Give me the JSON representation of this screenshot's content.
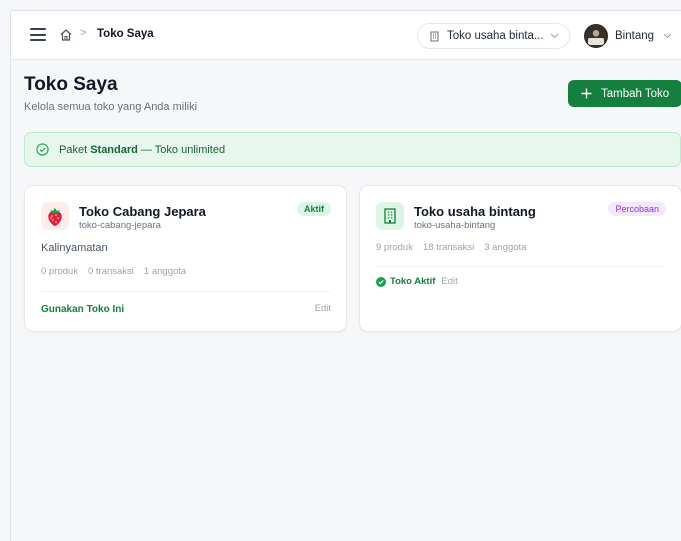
{
  "breadcrumb": {
    "current": "Toko Saya",
    "separator": ">"
  },
  "store_selector": {
    "value": "Toko usaha binta..."
  },
  "user": {
    "name": "Bintang"
  },
  "header": {
    "title": "Toko Saya",
    "subtitle": "Kelola semua toko yang Anda miliki"
  },
  "add_button": {
    "label": "Tambah Toko"
  },
  "plan_banner": {
    "prefix": "Paket ",
    "plan": "Standard",
    "suffix": " — Toko unlimited"
  },
  "stores": [
    {
      "name": "Toko Cabang Jepara",
      "slug": "toko-cabang-jepara",
      "badge": "Aktif",
      "location": "Kalinyamatan",
      "stats": [
        "0 produk",
        "0 transaksi",
        "1 anggota"
      ],
      "action": "Gunakan Toko Ini",
      "edit": "Edit",
      "icon": "strawberry-icon"
    },
    {
      "name": "Toko usaha bintang",
      "slug": "toko-usaha-bintang",
      "badge": "Percobaan",
      "stats": [
        "9 produk",
        "18 transaksi",
        "3 anggota"
      ],
      "status": "Toko Aktif",
      "edit": "Edit",
      "icon": "building-icon"
    }
  ],
  "colors": {
    "accent": "#15803d",
    "trial_badge": "#9333ea",
    "banner_bg": "#e8f7ee"
  }
}
